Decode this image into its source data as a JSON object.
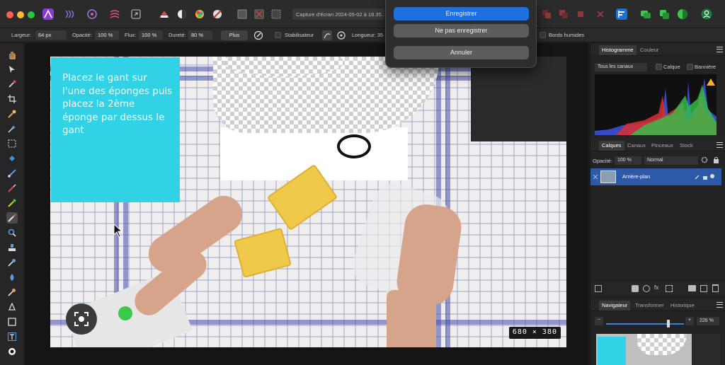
{
  "toolbar": {
    "document_title": "Capture d'écran 2024-05-02 à 18.35...",
    "window_controls": [
      "close",
      "minimize",
      "zoom"
    ]
  },
  "context_bar": {
    "width_label": "Largeur:",
    "width_value": "64 px",
    "opacity_label": "Opacité:",
    "opacity_value": "100 %",
    "flow_label": "Flux:",
    "flow_value": "100 %",
    "hardness_label": "Dureté:",
    "hardness_value": "80 %",
    "more_button": "Plus",
    "stabilizer_label": "Stabilisateur",
    "length_label": "Longueur: 35",
    "wrap_label": "Bords humides"
  },
  "dialog": {
    "save": "Enregistrer",
    "dont_save": "Ne pas enregistrer",
    "cancel": "Annuler"
  },
  "canvas": {
    "note_text": "Placez le gant sur l'une des éponges puis placez la 2ème éponge par dessus le gant",
    "dimensions_badge": "680 × 380"
  },
  "histogram_panel": {
    "tabs": [
      "Histogramme",
      "Couleur"
    ],
    "channel_select": "Tous les canaux",
    "layer_checkbox": "Calque",
    "marquee_checkbox": "Bannière"
  },
  "layers_panel": {
    "tabs": [
      "Calques",
      "Canaux",
      "Pinceaux",
      "Stock"
    ],
    "opacity_label": "Opacité:",
    "opacity_value": "100 %",
    "blend_mode": "Normal",
    "layers": [
      {
        "name": "Arrière-plan"
      }
    ]
  },
  "navigator_panel": {
    "tabs": [
      "Navigateur",
      "Transformer",
      "Historique"
    ],
    "zoom_value": "226 %",
    "zoom_minus": "−",
    "zoom_plus": "+"
  },
  "colors": {
    "accent": "#1f6fe0",
    "note_bg": "#31d1e6",
    "layer_selected": "#2d5aa8"
  }
}
